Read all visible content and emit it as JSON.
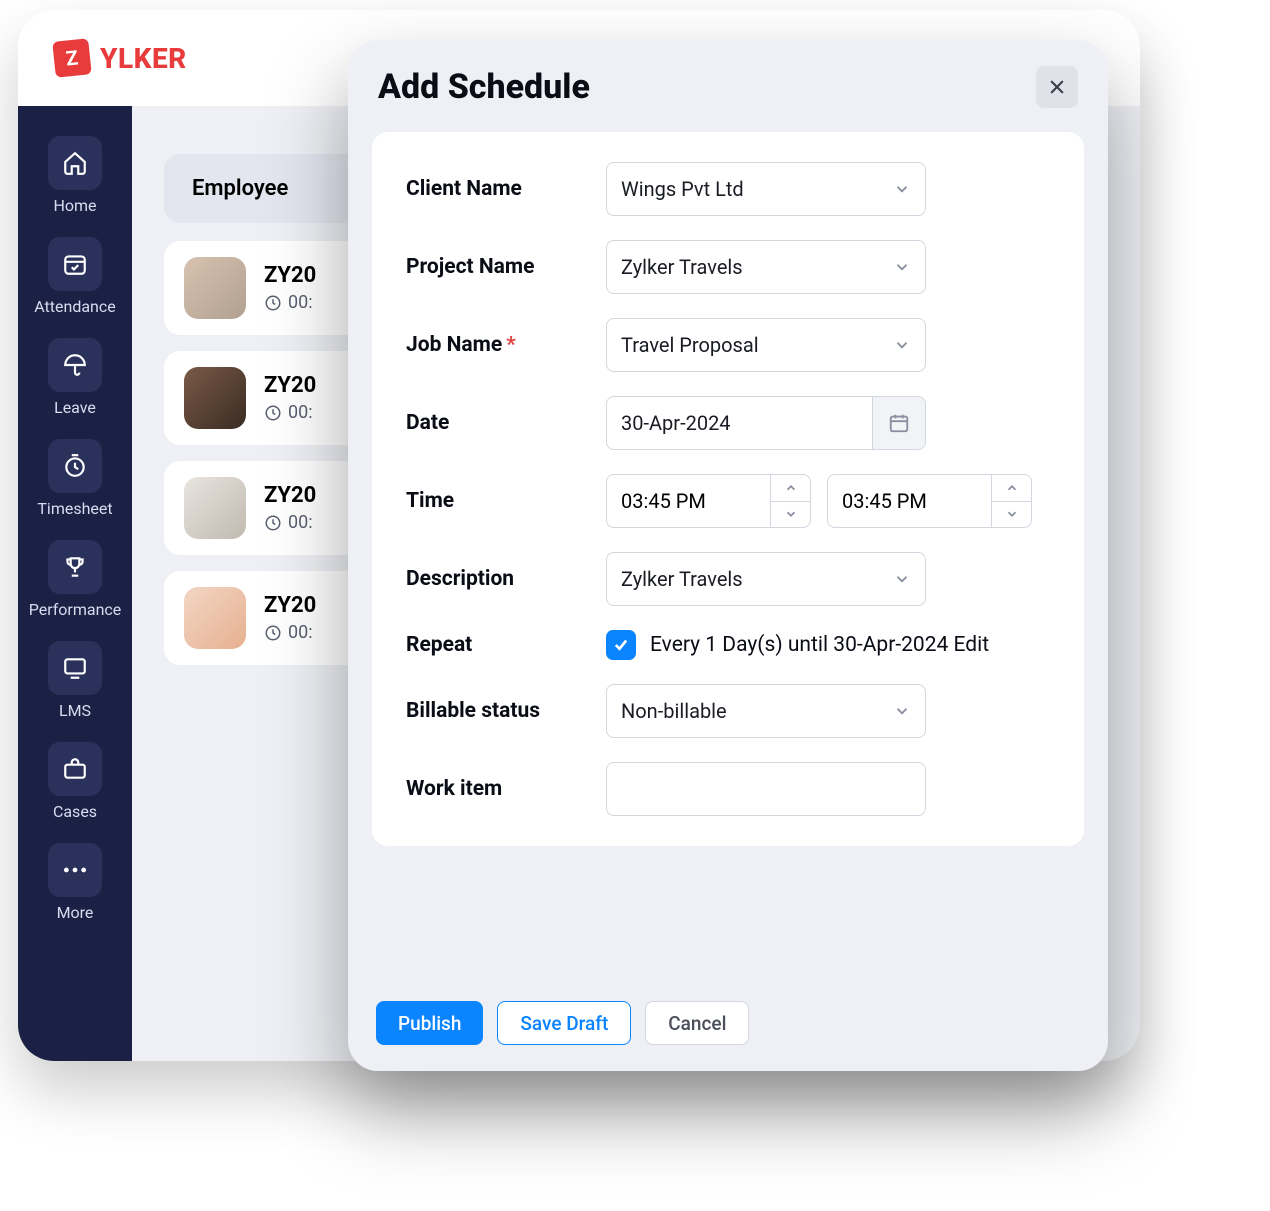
{
  "brand": {
    "badge": "Z",
    "name": "YLKER"
  },
  "sidebar": {
    "items": [
      {
        "label": "Home"
      },
      {
        "label": "Attendance"
      },
      {
        "label": "Leave"
      },
      {
        "label": "Timesheet"
      },
      {
        "label": "Performance"
      },
      {
        "label": "LMS"
      },
      {
        "label": "Cases"
      },
      {
        "label": "More"
      }
    ]
  },
  "list": {
    "header": "Employee",
    "rows": [
      {
        "id": "ZY20",
        "time": "00:"
      },
      {
        "id": "ZY20",
        "time": "00:"
      },
      {
        "id": "ZY20",
        "time": "00:"
      },
      {
        "id": "ZY20",
        "time": "00:"
      }
    ]
  },
  "modal": {
    "title": "Add Schedule",
    "labels": {
      "client": "Client Name",
      "project": "Project Name",
      "job": "Job Name",
      "date": "Date",
      "time": "Time",
      "description": "Description",
      "repeat": "Repeat",
      "billable": "Billable status",
      "workitem": "Work item"
    },
    "values": {
      "client": "Wings Pvt Ltd",
      "project": "Zylker Travels",
      "job": "Travel Proposal",
      "date": "30-Apr-2024",
      "time_from": "03:45 PM",
      "time_to": "03:45 PM",
      "description": "Zylker Travels",
      "repeat_checked": true,
      "repeat_text": "Every 1 Day(s) until 30-Apr-2024 Edit",
      "billable": "Non-billable",
      "workitem": ""
    },
    "buttons": {
      "publish": "Publish",
      "draft": "Save Draft",
      "cancel": "Cancel"
    }
  }
}
